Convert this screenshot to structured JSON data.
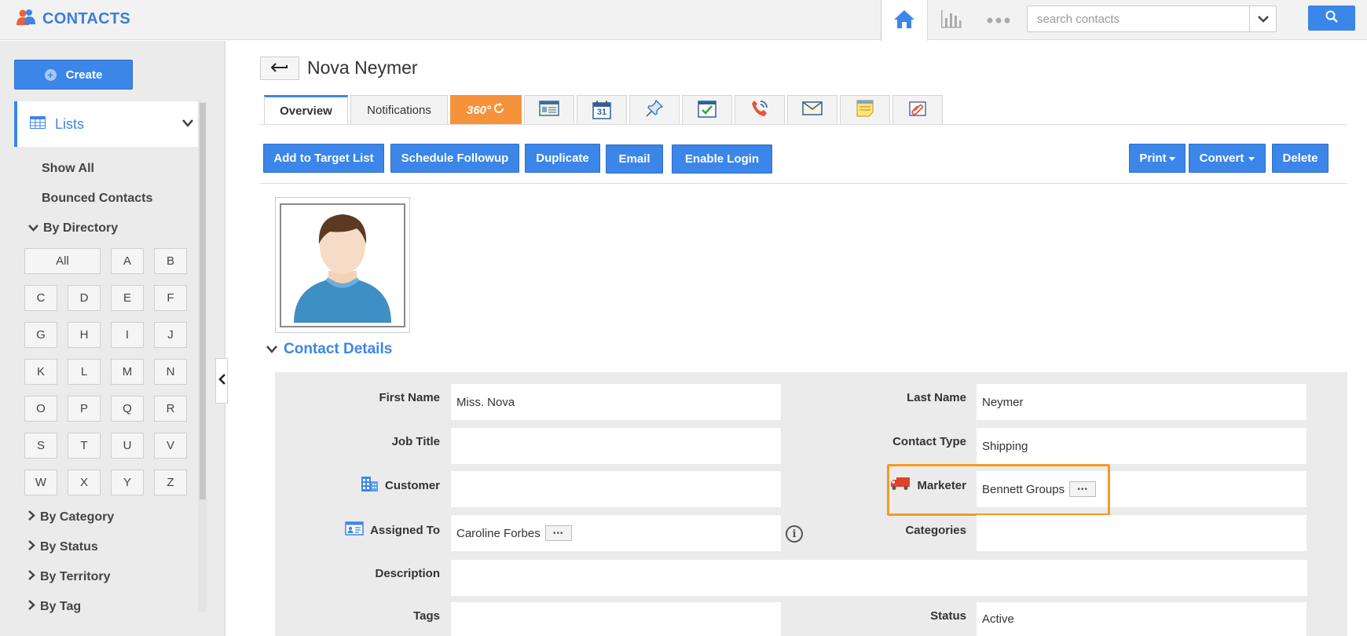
{
  "app": {
    "title": "CONTACTS"
  },
  "topbar": {
    "search_placeholder": "search contacts",
    "icons": [
      "home-icon",
      "reports-icon",
      "more-icon",
      "dropdown-chevron-icon",
      "search-icon"
    ]
  },
  "sidebar": {
    "create_label": "Create",
    "lists_label": "Lists",
    "links": [
      "Show All",
      "Bounced Contacts"
    ],
    "by_directory": "By Directory",
    "letters": [
      "All",
      "A",
      "B",
      "C",
      "D",
      "E",
      "F",
      "G",
      "H",
      "I",
      "J",
      "K",
      "L",
      "M",
      "N",
      "O",
      "P",
      "Q",
      "R",
      "S",
      "T",
      "U",
      "V",
      "W",
      "X",
      "Y",
      "Z"
    ],
    "groups": [
      "By Category",
      "By Status",
      "By Territory",
      "By Tag"
    ]
  },
  "page": {
    "title": "Nova Neymer"
  },
  "tabs": {
    "overview": "Overview",
    "notifications": "Notifications",
    "t360": "360°",
    "icon_tabs": [
      "details-icon",
      "calendar-icon",
      "pin-icon",
      "task-icon",
      "call-icon",
      "mail-icon",
      "note-icon",
      "attachment-icon"
    ],
    "calendar_day": "31"
  },
  "actions": {
    "add_to_target_list": "Add to Target List",
    "schedule_followup": "Schedule Followup",
    "duplicate": "Duplicate",
    "email": "Email",
    "enable_login": "Enable Login",
    "print": "Print",
    "convert": "Convert",
    "delete": "Delete"
  },
  "section": {
    "title": "Contact Details"
  },
  "fields": {
    "first_name": {
      "label": "First Name",
      "value": "Miss. Nova"
    },
    "last_name": {
      "label": "Last Name",
      "value": "Neymer"
    },
    "job_title": {
      "label": "Job Title",
      "value": ""
    },
    "contact_type": {
      "label": "Contact Type",
      "value": "Shipping"
    },
    "customer": {
      "label": "Customer",
      "value": ""
    },
    "marketer": {
      "label": "Marketer",
      "value": "Bennett Groups"
    },
    "assigned_to": {
      "label": "Assigned To",
      "value": "Caroline Forbes"
    },
    "categories": {
      "label": "Categories",
      "value": ""
    },
    "description": {
      "label": "Description",
      "value": ""
    },
    "tags": {
      "label": "Tags",
      "value": ""
    },
    "status": {
      "label": "Status",
      "value": "Active"
    }
  },
  "colors": {
    "accent": "#3b86e8",
    "highlight": "#f59a22",
    "tab_360": "#f5923a"
  }
}
